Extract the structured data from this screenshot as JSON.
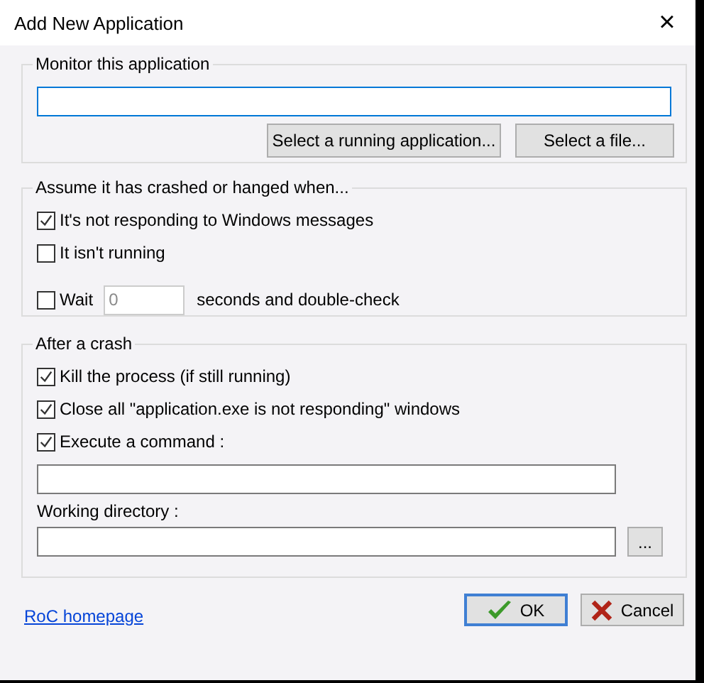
{
  "window": {
    "title": "Add New Application",
    "close": "×"
  },
  "monitor": {
    "title": "Monitor this application",
    "buttons": [
      "Select a running application...",
      "Select a file..."
    ]
  },
  "crash_conditions": {
    "title": "Assume it has crashed or hanged when...",
    "options": [
      {
        "kind": "checkbox",
        "label": "It's not responding to Windows messages",
        "checked": true
      },
      {
        "kind": "checkbox",
        "label": "It isn't running",
        "checked": false
      },
      {
        "kind": "wait",
        "label": "Wait",
        "checked": false,
        "placeholder": "0",
        "suffix": "seconds and double-check"
      }
    ]
  },
  "after_crash": {
    "title": "After a crash",
    "options": [
      {
        "label": "Kill the process (if still running)",
        "checked": true
      },
      {
        "label": "Close all \"application.exe is not responding\" windows",
        "checked": true
      },
      {
        "label": "Execute a command :",
        "checked": true
      }
    ],
    "working_directory_label": "Working directory :",
    "browse_button": "..."
  },
  "footer": {
    "link": "RoC homepage",
    "ok": "OK",
    "cancel": "Cancel"
  }
}
